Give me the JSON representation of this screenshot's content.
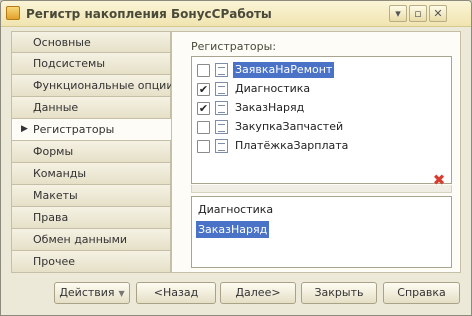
{
  "window": {
    "title": "Регистр накопления БонусСРаботы",
    "menu_glyph": "▾",
    "minimize_glyph": "▫",
    "close_glyph": "✕"
  },
  "tabs": [
    {
      "label": "Основные"
    },
    {
      "label": "Подсистемы"
    },
    {
      "label": "Функциональные опции"
    },
    {
      "label": "Данные"
    },
    {
      "label": "Регистраторы",
      "active": true
    },
    {
      "label": "Формы"
    },
    {
      "label": "Команды"
    },
    {
      "label": "Макеты"
    },
    {
      "label": "Права"
    },
    {
      "label": "Обмен данными"
    },
    {
      "label": "Прочее"
    }
  ],
  "registrators": {
    "label": "Регистраторы:",
    "items": [
      {
        "name": "ЗаявкаНаРемонт",
        "checked": false,
        "check_glyph": "",
        "selected": true
      },
      {
        "name": "Диагностика",
        "checked": true,
        "check_glyph": "✔",
        "selected": false
      },
      {
        "name": "ЗаказНаряд",
        "checked": true,
        "check_glyph": "✔",
        "selected": false
      },
      {
        "name": "ЗакупкаЗапчастей",
        "checked": false,
        "check_glyph": "",
        "selected": false
      },
      {
        "name": "ПлатёжкаЗарплата",
        "checked": false,
        "check_glyph": "",
        "selected": false
      }
    ],
    "delete_glyph": "✖"
  },
  "selected_list": {
    "items": [
      {
        "name": "Диагностика",
        "selected": false
      },
      {
        "name": "ЗаказНаряд",
        "selected": true
      }
    ]
  },
  "buttons": {
    "actions": "Действия",
    "actions_caret": "▼",
    "back": "<Назад",
    "next": "Далее>",
    "close": "Закрыть",
    "help": "Справка"
  }
}
